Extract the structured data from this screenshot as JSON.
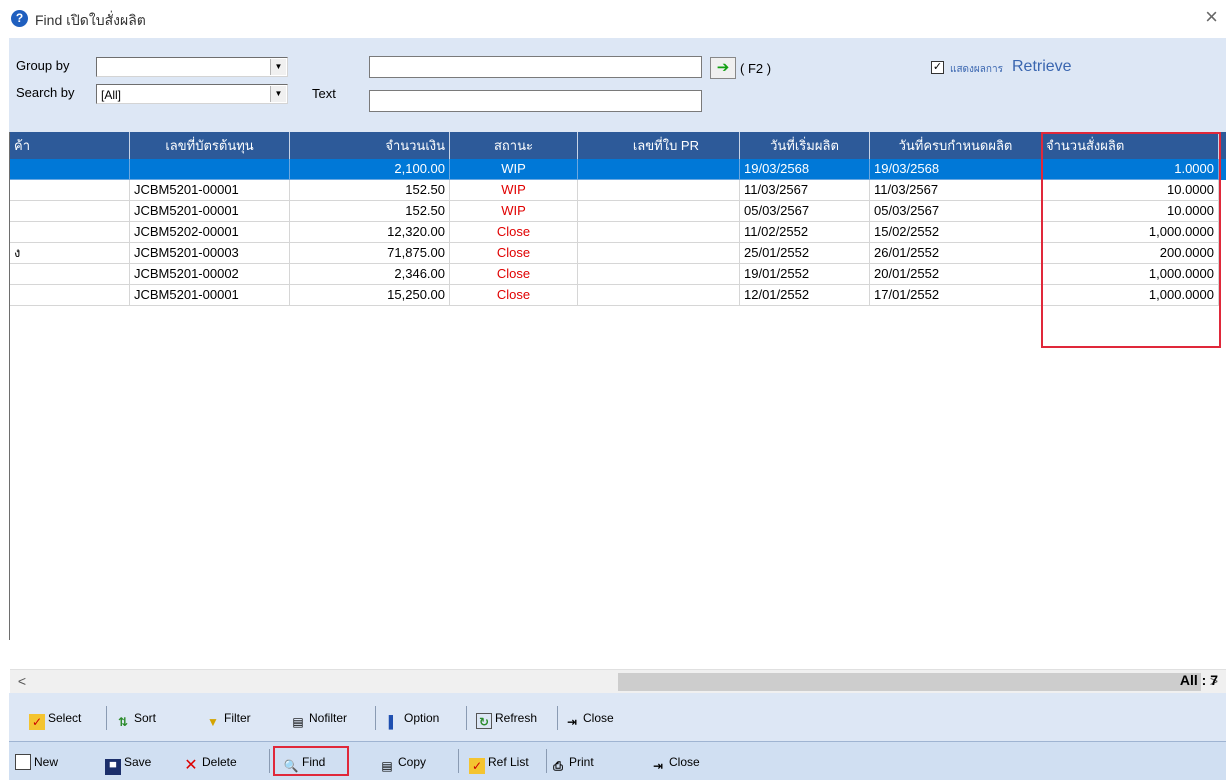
{
  "window": {
    "title": "Find เปิดใบสั่งผลิต",
    "close_glyph": "×"
  },
  "form": {
    "group_by_label": "Group by",
    "group_by_value": "",
    "search_by_label": "Search by",
    "search_by_value": "[All]",
    "text_label": "Text",
    "text_value": "",
    "top_input_value": "",
    "f2_label": "( F2 )",
    "retrieve_thai": "แสดงผลการ",
    "retrieve_label": "Retrieve",
    "retrieve_checked": true
  },
  "grid": {
    "columns": [
      "ค้า",
      "เลขที่บัตรต้นทุน",
      "จำนวนเงิน",
      "สถานะ",
      "เลขที่ใบ PR",
      "วันที่เริ่มผลิต",
      "วันที่ครบกำหนดผลิต",
      "จำนวนสั่งผลิต"
    ],
    "rows": [
      [
        "",
        "",
        "2,100.00",
        "WIP",
        "",
        "19/03/2568",
        "19/03/2568",
        "1.0000"
      ],
      [
        "",
        "JCBM5201-00001",
        "152.50",
        "WIP",
        "",
        "11/03/2567",
        "11/03/2567",
        "10.0000"
      ],
      [
        "",
        "JCBM5201-00001",
        "152.50",
        "WIP",
        "",
        "05/03/2567",
        "05/03/2567",
        "10.0000"
      ],
      [
        "",
        "JCBM5202-00001",
        "12,320.00",
        "Close",
        "",
        "11/02/2552",
        "15/02/2552",
        "1,000.0000"
      ],
      [
        "ง",
        "JCBM5201-00003",
        "71,875.00",
        "Close",
        "",
        "25/01/2552",
        "26/01/2552",
        "200.0000"
      ],
      [
        "",
        "JCBM5201-00002",
        "2,346.00",
        "Close",
        "",
        "19/01/2552",
        "20/01/2552",
        "1,000.0000"
      ],
      [
        "",
        "JCBM5201-00001",
        "15,250.00",
        "Close",
        "",
        "12/01/2552",
        "17/01/2552",
        "1,000.0000"
      ]
    ],
    "selected_row": 0,
    "scroll_left": "<",
    "scroll_right": ">"
  },
  "toolbar1": {
    "select": "Select",
    "sort": "Sort",
    "filter": "Filter",
    "nofilter": "Nofilter",
    "option": "Option",
    "refresh": "Refresh",
    "close": "Close"
  },
  "status": {
    "all_count": "All : 7"
  },
  "toolbar2": {
    "new": "New",
    "save": "Save",
    "delete": "Delete",
    "find": "Find",
    "copy": "Copy",
    "ref_list": "Ref List",
    "print": "Print",
    "close": "Close"
  },
  "colors": {
    "header_bg": "#2d5a99",
    "selected_row": "#0078d7",
    "status_red": "#e00000",
    "highlight_box": "#e0283a",
    "panel_bg": "#dde7f5"
  }
}
